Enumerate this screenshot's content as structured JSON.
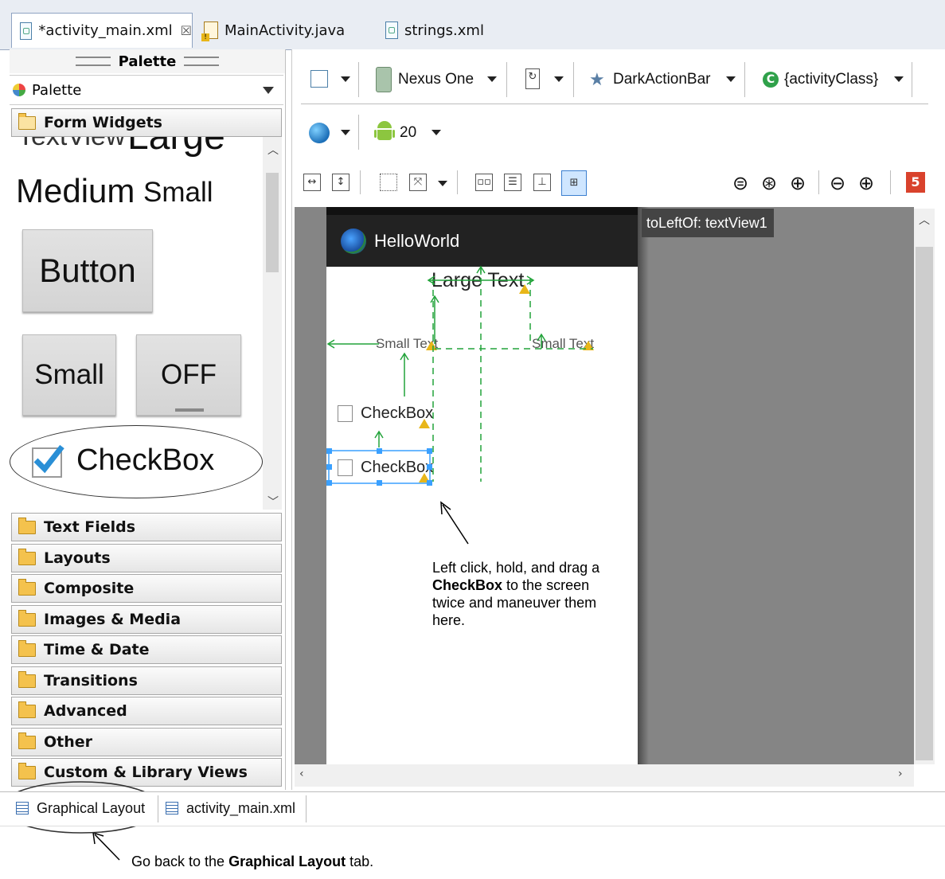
{
  "editor_tabs": [
    {
      "label": "*activity_main.xml",
      "close": "☒",
      "active": true
    },
    {
      "label": "MainActivity.java",
      "active": false
    },
    {
      "label": "strings.xml",
      "active": false
    }
  ],
  "palette": {
    "header": "Palette",
    "selector": "Palette",
    "open_category": "Form Widgets",
    "widgets": {
      "large_text": "Large",
      "textview_partial": "TextView",
      "medium_text": "Medium",
      "small_text": "Small",
      "button": "Button",
      "small_button": "Small",
      "toggle": "OFF",
      "checkbox": "CheckBox"
    },
    "categories": [
      "Text Fields",
      "Layouts",
      "Composite",
      "Images & Media",
      "Time & Date",
      "Transitions",
      "Advanced",
      "Other",
      "Custom & Library Views"
    ]
  },
  "toolbar": {
    "device": "Nexus One",
    "theme": "DarkActionBar",
    "activity": "{activityClass}",
    "api_level": "20",
    "error_count": "5"
  },
  "canvas": {
    "tooltip": "toLeftOf: textView1",
    "app_title": "HelloWorld",
    "large_text": "Large Text",
    "small_text_left": "Small Text",
    "small_text_right": "Small Text",
    "checkbox1": "CheckBox",
    "checkbox2": "CheckBox"
  },
  "bottom_tabs": [
    {
      "label": "Graphical Layout",
      "active": true
    },
    {
      "label": "activity_main.xml",
      "active": false
    }
  ],
  "annotations": {
    "drag_note": {
      "line1": "Left click, hold, and drag a",
      "bold": "CheckBox",
      "line2_rest": " to the screen",
      "line3": "twice and maneuver them",
      "line4": "here."
    },
    "back_note": {
      "prefix": "Go back to the ",
      "bold": "Graphical Layout",
      "suffix": " tab."
    }
  }
}
